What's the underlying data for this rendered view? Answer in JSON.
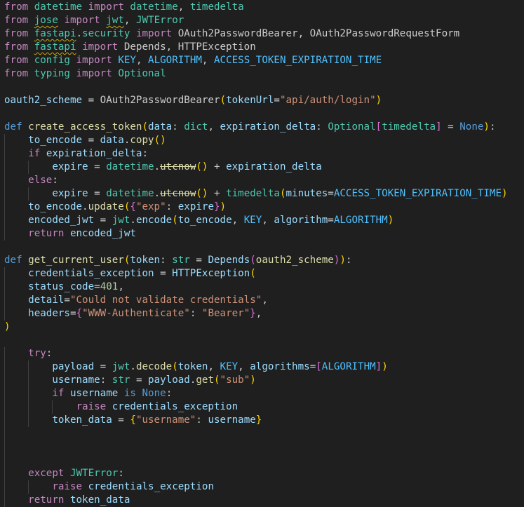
{
  "editor": {
    "language": "python",
    "colors": {
      "background": "#1f1f1f",
      "keyword": "#c586c0",
      "def_keyword": "#569cd6",
      "function": "#dcdcaa",
      "variable": "#9cdcfe",
      "type": "#4ec9b0",
      "string": "#ce9178",
      "number": "#b5cea8",
      "constant": "#4fc1ff",
      "bracket_level_1": "#ffd700",
      "bracket_level_2": "#da70d6",
      "bracket_level_3": "#179fff"
    },
    "lines": [
      {
        "indent": 0,
        "tokens": [
          [
            "kw",
            "from"
          ],
          [
            "p",
            " "
          ],
          [
            "type",
            "datetime"
          ],
          [
            "p",
            " "
          ],
          [
            "kw",
            "import"
          ],
          [
            "p",
            " "
          ],
          [
            "type",
            "datetime"
          ],
          [
            "p",
            ", "
          ],
          [
            "type",
            "timedelta"
          ]
        ]
      },
      {
        "indent": 0,
        "tokens": [
          [
            "kw",
            "from"
          ],
          [
            "p",
            " "
          ],
          [
            "squig",
            "jose"
          ],
          [
            "p",
            " "
          ],
          [
            "kw",
            "import"
          ],
          [
            "p",
            " "
          ],
          [
            "squig",
            "jwt"
          ],
          [
            "p",
            ", "
          ],
          [
            "type",
            "JWTError"
          ]
        ]
      },
      {
        "indent": 0,
        "tokens": [
          [
            "kw",
            "from"
          ],
          [
            "p",
            " "
          ],
          [
            "squig",
            "fastapi"
          ],
          [
            "p",
            "."
          ],
          [
            "type",
            "security"
          ],
          [
            "p",
            " "
          ],
          [
            "kw",
            "import"
          ],
          [
            "p",
            " OAuth2PasswordBearer, "
          ],
          [
            "dim",
            "OAuth2PasswordRequestForm"
          ]
        ]
      },
      {
        "indent": 0,
        "tokens": [
          [
            "kw",
            "from"
          ],
          [
            "p",
            " "
          ],
          [
            "squig",
            "fastapi"
          ],
          [
            "p",
            " "
          ],
          [
            "kw",
            "import"
          ],
          [
            "p",
            " Depends, HTTPException"
          ]
        ]
      },
      {
        "indent": 0,
        "tokens": [
          [
            "kw",
            "from"
          ],
          [
            "p",
            " "
          ],
          [
            "type",
            "config"
          ],
          [
            "p",
            " "
          ],
          [
            "kw",
            "import"
          ],
          [
            "p",
            " "
          ],
          [
            "const",
            "KEY"
          ],
          [
            "p",
            ", "
          ],
          [
            "const",
            "ALGORITHM"
          ],
          [
            "p",
            ", "
          ],
          [
            "const",
            "ACCESS_TOKEN_EXPIRATION_TIME"
          ]
        ]
      },
      {
        "indent": 0,
        "tokens": [
          [
            "kw",
            "from"
          ],
          [
            "p",
            " "
          ],
          [
            "type",
            "typing"
          ],
          [
            "p",
            " "
          ],
          [
            "kw",
            "import"
          ],
          [
            "p",
            " "
          ],
          [
            "type",
            "Optional"
          ]
        ]
      },
      {
        "indent": 0,
        "tokens": []
      },
      {
        "indent": 0,
        "tokens": [
          [
            "var",
            "oauth2_scheme"
          ],
          [
            "p",
            " = OAuth2PasswordBearer"
          ],
          [
            "b1",
            "("
          ],
          [
            "var",
            "tokenUrl"
          ],
          [
            "p",
            "="
          ],
          [
            "str",
            "\"api/auth/login\""
          ],
          [
            "b1",
            ")"
          ]
        ]
      },
      {
        "indent": 0,
        "tokens": []
      },
      {
        "indent": 0,
        "tokens": [
          [
            "def",
            "def"
          ],
          [
            "p",
            " "
          ],
          [
            "fn",
            "create_access_token"
          ],
          [
            "b1",
            "("
          ],
          [
            "var",
            "data"
          ],
          [
            "p",
            ": "
          ],
          [
            "type",
            "dict"
          ],
          [
            "p",
            ", "
          ],
          [
            "var",
            "expiration_delta"
          ],
          [
            "p",
            ": "
          ],
          [
            "type",
            "Optional"
          ],
          [
            "b2",
            "["
          ],
          [
            "type",
            "timedelta"
          ],
          [
            "b2",
            "]"
          ],
          [
            "p",
            " = "
          ],
          [
            "def",
            "None"
          ],
          [
            "b1",
            ")"
          ],
          [
            "p",
            ":"
          ]
        ]
      },
      {
        "indent": 1,
        "tokens": [
          [
            "var",
            "to_encode"
          ],
          [
            "p",
            " = "
          ],
          [
            "var",
            "data"
          ],
          [
            "p",
            "."
          ],
          [
            "fn",
            "copy"
          ],
          [
            "b1",
            "()"
          ]
        ]
      },
      {
        "indent": 1,
        "tokens": [
          [
            "kw",
            "if"
          ],
          [
            "p",
            " "
          ],
          [
            "var",
            "expiration_delta"
          ],
          [
            "p",
            ":"
          ]
        ]
      },
      {
        "indent": 2,
        "tokens": [
          [
            "var",
            "expire"
          ],
          [
            "p",
            " = "
          ],
          [
            "type",
            "datetime"
          ],
          [
            "p",
            "."
          ],
          [
            "strike",
            "utcnow"
          ],
          [
            "b1",
            "()"
          ],
          [
            "p",
            " + "
          ],
          [
            "var",
            "expiration_delta"
          ]
        ]
      },
      {
        "indent": 1,
        "tokens": [
          [
            "kw",
            "else"
          ],
          [
            "p",
            ":"
          ]
        ]
      },
      {
        "indent": 2,
        "tokens": [
          [
            "var",
            "expire"
          ],
          [
            "p",
            " = "
          ],
          [
            "type",
            "datetime"
          ],
          [
            "p",
            "."
          ],
          [
            "strike",
            "utcnow"
          ],
          [
            "b1",
            "()"
          ],
          [
            "p",
            " + "
          ],
          [
            "type",
            "timedelta"
          ],
          [
            "b1",
            "("
          ],
          [
            "var",
            "minutes"
          ],
          [
            "p",
            "="
          ],
          [
            "const",
            "ACCESS_TOKEN_EXPIRATION_TIME"
          ],
          [
            "b1",
            ")"
          ]
        ]
      },
      {
        "indent": 1,
        "tokens": [
          [
            "var",
            "to_encode"
          ],
          [
            "p",
            "."
          ],
          [
            "fn",
            "update"
          ],
          [
            "b1",
            "("
          ],
          [
            "b2",
            "{"
          ],
          [
            "str",
            "\"exp\""
          ],
          [
            "p",
            ": "
          ],
          [
            "var",
            "expire"
          ],
          [
            "b2",
            "}"
          ],
          [
            "b1",
            ")"
          ]
        ]
      },
      {
        "indent": 1,
        "tokens": [
          [
            "var",
            "encoded_jwt"
          ],
          [
            "p",
            " = "
          ],
          [
            "type",
            "jwt"
          ],
          [
            "p",
            "."
          ],
          [
            "var",
            "encode"
          ],
          [
            "b1",
            "("
          ],
          [
            "var",
            "to_encode"
          ],
          [
            "p",
            ", "
          ],
          [
            "const",
            "KEY"
          ],
          [
            "p",
            ", "
          ],
          [
            "var",
            "algorithm"
          ],
          [
            "p",
            "="
          ],
          [
            "const",
            "ALGORITHM"
          ],
          [
            "b1",
            ")"
          ]
        ]
      },
      {
        "indent": 1,
        "tokens": [
          [
            "kw",
            "return"
          ],
          [
            "p",
            " "
          ],
          [
            "var",
            "encoded_jwt"
          ]
        ]
      },
      {
        "indent": 0,
        "tokens": []
      },
      {
        "indent": 0,
        "tokens": [
          [
            "def",
            "def"
          ],
          [
            "p",
            " "
          ],
          [
            "fn",
            "get_current_user"
          ],
          [
            "b1",
            "("
          ],
          [
            "var",
            "token"
          ],
          [
            "p",
            ": "
          ],
          [
            "type",
            "str"
          ],
          [
            "p",
            " = "
          ],
          [
            "var",
            "Depends"
          ],
          [
            "b2",
            "("
          ],
          [
            "fn",
            "oauth2_scheme"
          ],
          [
            "b2",
            ")"
          ],
          [
            "b1",
            ")"
          ],
          [
            "p",
            ":"
          ]
        ]
      },
      {
        "indent": 1,
        "tokens": [
          [
            "var",
            "credentials_exception"
          ],
          [
            "p",
            " = "
          ],
          [
            "var",
            "HTTPException"
          ],
          [
            "b1",
            "("
          ]
        ]
      },
      {
        "indent": 1,
        "tokens": [
          [
            "var",
            "status_code"
          ],
          [
            "p",
            "="
          ],
          [
            "num",
            "401"
          ],
          [
            "p",
            ","
          ]
        ]
      },
      {
        "indent": 1,
        "tokens": [
          [
            "var",
            "detail"
          ],
          [
            "p",
            "="
          ],
          [
            "str",
            "\"Could not validate credentials\""
          ],
          [
            "p",
            ","
          ]
        ]
      },
      {
        "indent": 1,
        "tokens": [
          [
            "var",
            "headers"
          ],
          [
            "p",
            "="
          ],
          [
            "b2",
            "{"
          ],
          [
            "str",
            "\"WWW-Authenticate\""
          ],
          [
            "p",
            ": "
          ],
          [
            "str",
            "\"Bearer\""
          ],
          [
            "b2",
            "}"
          ],
          [
            "p",
            ","
          ]
        ]
      },
      {
        "indent": 0,
        "tokens": [
          [
            "b1",
            ")"
          ]
        ]
      },
      {
        "indent": 0,
        "tokens": []
      },
      {
        "indent": 1,
        "tokens": [
          [
            "kw",
            "try"
          ],
          [
            "p",
            ":"
          ]
        ]
      },
      {
        "indent": 2,
        "tokens": [
          [
            "var",
            "payload"
          ],
          [
            "p",
            " = "
          ],
          [
            "type",
            "jwt"
          ],
          [
            "p",
            "."
          ],
          [
            "fn",
            "decode"
          ],
          [
            "b1",
            "("
          ],
          [
            "var",
            "token"
          ],
          [
            "p",
            ", "
          ],
          [
            "const",
            "KEY"
          ],
          [
            "p",
            ", "
          ],
          [
            "var",
            "algorithms"
          ],
          [
            "p",
            "="
          ],
          [
            "b2",
            "["
          ],
          [
            "const",
            "ALGORITHM"
          ],
          [
            "b2",
            "]"
          ],
          [
            "b1",
            ")"
          ]
        ]
      },
      {
        "indent": 2,
        "tokens": [
          [
            "var",
            "username"
          ],
          [
            "p",
            ": "
          ],
          [
            "type",
            "str"
          ],
          [
            "p",
            " = "
          ],
          [
            "var",
            "payload"
          ],
          [
            "p",
            "."
          ],
          [
            "fn",
            "get"
          ],
          [
            "b1",
            "("
          ],
          [
            "str",
            "\"sub\""
          ],
          [
            "b1",
            ")"
          ]
        ]
      },
      {
        "indent": 2,
        "tokens": [
          [
            "kw",
            "if"
          ],
          [
            "p",
            " "
          ],
          [
            "var",
            "username"
          ],
          [
            "p",
            " "
          ],
          [
            "def",
            "is"
          ],
          [
            "p",
            " "
          ],
          [
            "def",
            "None"
          ],
          [
            "p",
            ":"
          ]
        ]
      },
      {
        "indent": 3,
        "tokens": [
          [
            "kw",
            "raise"
          ],
          [
            "p",
            " "
          ],
          [
            "var",
            "credentials_exception"
          ]
        ]
      },
      {
        "indent": 2,
        "tokens": [
          [
            "var",
            "token_data"
          ],
          [
            "p",
            " = "
          ],
          [
            "b1",
            "{"
          ],
          [
            "str",
            "\"username\""
          ],
          [
            "p",
            ": "
          ],
          [
            "var",
            "username"
          ],
          [
            "b1",
            "}"
          ]
        ]
      },
      {
        "indent": 1,
        "tokens": []
      },
      {
        "indent": 1,
        "tokens": []
      },
      {
        "indent": 1,
        "tokens": []
      },
      {
        "indent": 1,
        "tokens": [
          [
            "kw",
            "except"
          ],
          [
            "p",
            " "
          ],
          [
            "type",
            "JWTError"
          ],
          [
            "p",
            ":"
          ]
        ]
      },
      {
        "indent": 2,
        "tokens": [
          [
            "kw",
            "raise"
          ],
          [
            "p",
            " "
          ],
          [
            "var",
            "credentials_exception"
          ]
        ]
      },
      {
        "indent": 1,
        "tokens": [
          [
            "kw",
            "return"
          ],
          [
            "p",
            " "
          ],
          [
            "var",
            "token_data"
          ]
        ]
      }
    ]
  }
}
